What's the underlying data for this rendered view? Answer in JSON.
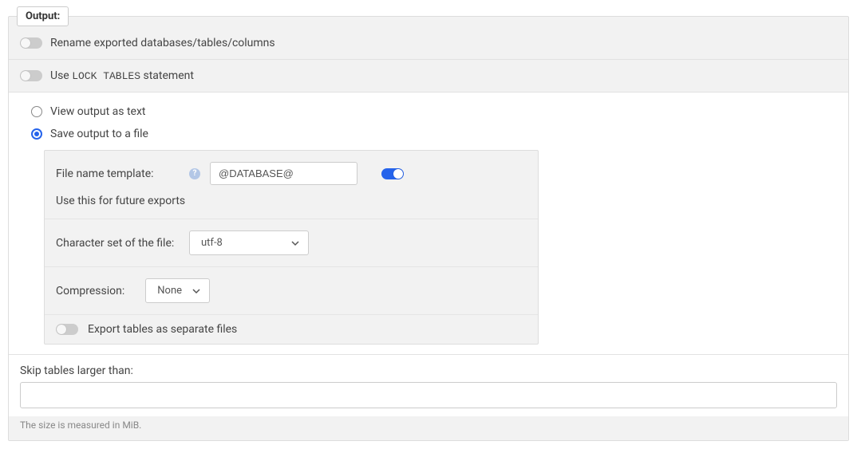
{
  "legend": "Output:",
  "options": {
    "rename_exported": "Rename exported databases/tables/columns",
    "use_lock_prefix": "Use ",
    "use_lock_mono": "LOCK TABLES",
    "use_lock_suffix": " statement"
  },
  "output_mode": {
    "view_text": "View output as text",
    "save_file": "Save output to a file"
  },
  "file_settings": {
    "template_label": "File name template:",
    "template_value": "@DATABASE@",
    "future_exports": "Use this for future exports",
    "charset_label": "Character set of the file:",
    "charset_value": "utf-8",
    "compression_label": "Compression:",
    "compression_value": "None",
    "export_separate": "Export tables as separate files"
  },
  "skip": {
    "label": "Skip tables larger than:",
    "value": "",
    "hint": "The size is measured in MiB."
  }
}
